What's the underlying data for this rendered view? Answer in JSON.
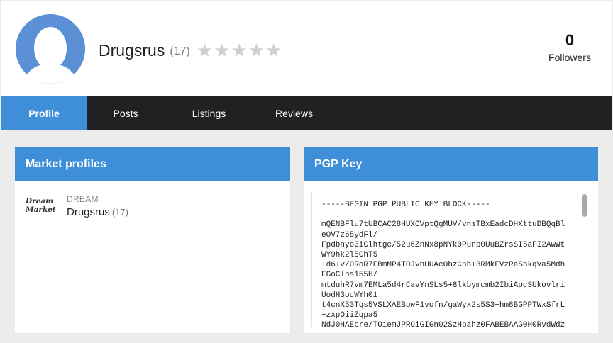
{
  "profile": {
    "username": "Drugsrus",
    "count": "(17)",
    "stars": [
      "★",
      "★",
      "★",
      "★",
      "★"
    ],
    "followers_count": "0",
    "followers_label": "Followers"
  },
  "nav": {
    "tabs": [
      {
        "label": "Profile",
        "active": true
      },
      {
        "label": "Posts",
        "active": false
      },
      {
        "label": "Listings",
        "active": false
      },
      {
        "label": "Reviews",
        "active": false
      }
    ]
  },
  "market_profiles": {
    "title": "Market profiles",
    "items": [
      {
        "logo_line1": "Dream",
        "logo_line2": "Market",
        "market": "DREAM",
        "username": "Drugsrus",
        "count": "(17)"
      }
    ]
  },
  "pgp": {
    "title": "PGP Key",
    "lines": [
      "-----BEGIN PGP PUBLIC KEY BLOCK-----",
      "",
      "mQENBFlu7tUBCAC28HUXOVptQgMUV/vnsTBxEadcDHXttuDBQqBl",
      "eOV7z65ydFl/",
      "Fpdbnyo3iClhtgc/52u6ZnNx8pNYk0Punp0UuBZrsSI5aFI2AwWt",
      "WY9hk2l5ChT5",
      "+d6+v/ORoR7FBmMP4TOJvnUUAcObzCnb+3RMkFVzReShkqVa5Mdh",
      "FGoClhs155H/",
      "mtduhR7vm7EMLa5d4rCavYnSLs5+8lkbymcmb2IbiApcSUkovlri",
      "UodH3ocWYh01",
      "t4cnX53Tqs5VSLXAEBpwF1vofn/gaWyx2s5S3+hm8BGPPTWxSfrL",
      "+zxpOiiZqpa5",
      "NdJ0HAEpre/TOiemJPROiGIGn02SzHpahz0FABEBAAG0H0RvdWdz"
    ]
  }
}
